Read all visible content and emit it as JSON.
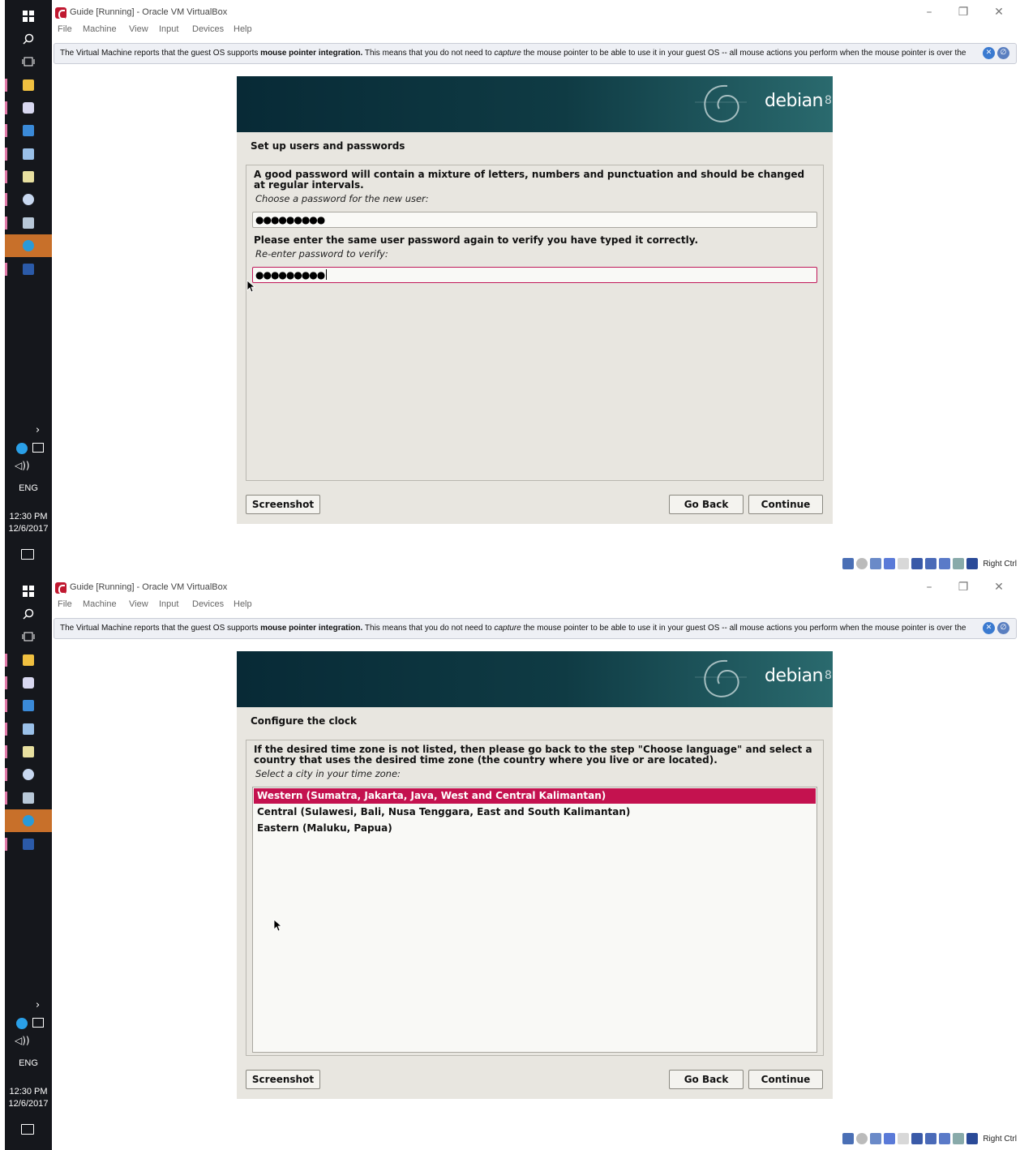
{
  "window": {
    "title": "Guide [Running] - Oracle VM VirtualBox",
    "menu": [
      "File",
      "Machine",
      "View",
      "Input",
      "Devices",
      "Help"
    ]
  },
  "notice": {
    "part1": "The Virtual Machine reports that the guest OS supports ",
    "bold": "mouse pointer integration.",
    "part2": " This means that you do not need to ",
    "italic": "capture",
    "part3": " the mouse pointer to be able to use it in your guest OS -- all mouse actions you perform when the mouse pointer is over the"
  },
  "taskbar": {
    "language": "ENG",
    "time": "12:30 PM",
    "date": "12/6/2017",
    "icons": [
      "windows-icon",
      "search-icon",
      "task-view-icon",
      "file-explorer-icon",
      "virtualbox-icon",
      "control-panel-icon",
      "files-icon",
      "notepad-icon",
      "paint-icon",
      "vm-icon",
      "telegram-icon",
      "word-icon"
    ]
  },
  "installer": {
    "brand": "debian",
    "version": "8",
    "buttons": {
      "screenshot": "Screenshot",
      "go_back": "Go Back",
      "continue": "Continue"
    }
  },
  "screen1": {
    "step_title": "Set up users and passwords",
    "info": "A good password will contain a mixture of letters, numbers and punctuation and should be changed at regular intervals.",
    "prompt1": "Choose a password for the new user:",
    "password1": "●●●●●●●●●",
    "info2": "Please enter the same user password again to verify you have typed it correctly.",
    "prompt2": "Re-enter password to verify:",
    "password2": "●●●●●●●●●"
  },
  "screen2": {
    "step_title": "Configure the clock",
    "info": "If the desired time zone is not listed, then please go back to the step \"Choose language\" and select a country that uses the desired time zone (the country where you live or are located).",
    "prompt": "Select a city in your time zone:",
    "options": [
      "Western (Sumatra, Jakarta, Java, West and Central Kalimantan)",
      "Central (Sulawesi, Bali, Nusa Tenggara, East and South Kalimantan)",
      "Eastern (Maluku, Papua)"
    ],
    "selected_index": 0
  },
  "status_bar": {
    "host_key": "Right Ctrl"
  },
  "colors": {
    "selection": "#c4124f",
    "banner": "#0f3b44",
    "taskbar": "#15171c"
  }
}
